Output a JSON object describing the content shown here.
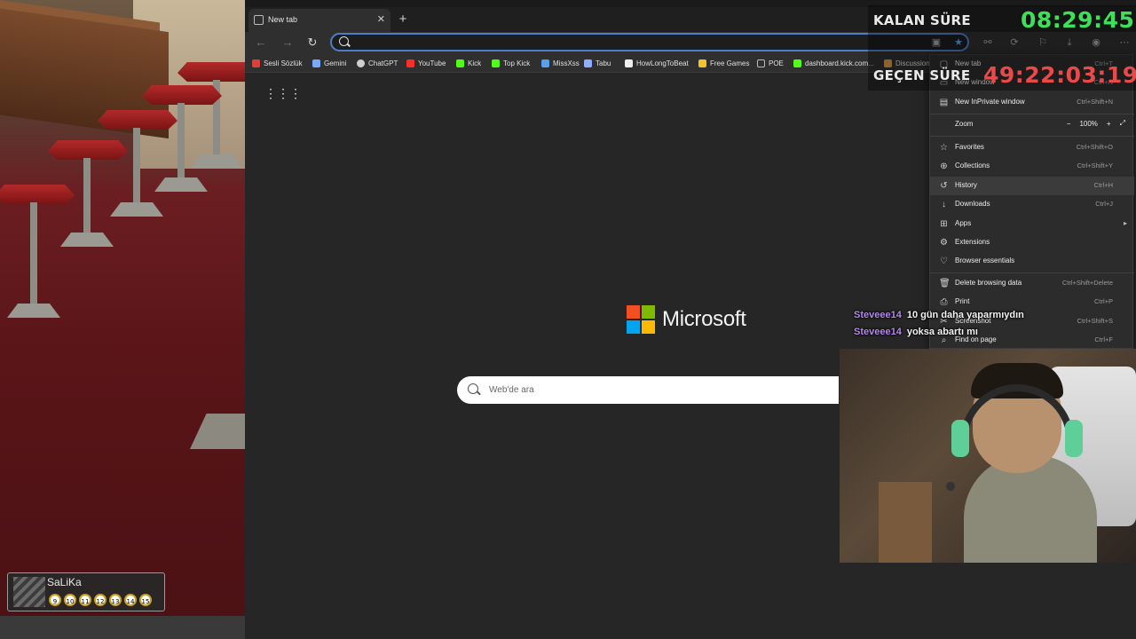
{
  "stream": {
    "timer": {
      "remaining_label": "KALAN SÜRE",
      "remaining_value": "08:29:45",
      "elapsed_label": "GEÇEN SÜRE",
      "elapsed_value": "49:22:03:19",
      "remaining_color": "#3ee05a",
      "elapsed_color": "#e84a4a"
    },
    "chat": [
      {
        "user": "Steveee14",
        "message": "10 gün daha yaparmıydın"
      },
      {
        "user": "Steveee14",
        "message": "yoksa abartı mı"
      }
    ],
    "game": {
      "player_name": "SaLiKa",
      "balls": [
        "9",
        "10",
        "11",
        "12",
        "13",
        "14",
        "15"
      ]
    }
  },
  "browser": {
    "tab": {
      "title": "New tab",
      "close_icon": "close-icon"
    },
    "new_tab_symbol": "+",
    "address": {
      "value": "",
      "placeholder": ""
    },
    "favorites": [
      {
        "label": "Sesli Sözlük",
        "color": "#d9413d"
      },
      {
        "label": "Gemini",
        "color": "#7aa7ff"
      },
      {
        "label": "ChatGPT",
        "color": "#cfcfcf"
      },
      {
        "label": "YouTube",
        "color": "#ff2a2a"
      },
      {
        "label": "Kick",
        "color": "#53fc18"
      },
      {
        "label": "Top Kick",
        "color": "#53fc18"
      },
      {
        "label": "MissXss",
        "color": "#5aa0e8"
      },
      {
        "label": "Tabu",
        "color": "#8fb0ff"
      },
      {
        "label": "HowLongToBeat",
        "color": "#eeeeee"
      },
      {
        "label": "Free Games",
        "color": "#f2c230"
      },
      {
        "label": "POE",
        "color": "#bbbbbb"
      },
      {
        "label": "dashboard.kick.com...",
        "color": "#53fc18"
      },
      {
        "label": "Discussion",
        "color": "#d39a4a"
      }
    ],
    "newtab": {
      "brand": "Microsoft",
      "search_placeholder": "Web'de ara"
    },
    "menu": {
      "items": [
        {
          "label": "New tab",
          "shortcut": "Ctrl+T",
          "icon": "new-tab-icon"
        },
        {
          "label": "New window",
          "shortcut": "Ctrl+N",
          "icon": "new-window-icon"
        },
        {
          "label": "New InPrivate window",
          "shortcut": "Ctrl+Shift+N",
          "icon": "inprivate-icon"
        },
        {
          "label": "Zoom",
          "shortcut": "",
          "icon": "zoom-icon"
        },
        {
          "label": "Favorites",
          "shortcut": "Ctrl+Shift+O",
          "icon": "star-icon"
        },
        {
          "label": "Collections",
          "shortcut": "Ctrl+Shift+Y",
          "icon": "collections-icon"
        },
        {
          "label": "History",
          "shortcut": "Ctrl+H",
          "icon": "history-icon"
        },
        {
          "label": "Downloads",
          "shortcut": "Ctrl+J",
          "icon": "download-icon"
        },
        {
          "label": "Apps",
          "shortcut": "",
          "icon": "apps-icon"
        },
        {
          "label": "Extensions",
          "shortcut": "",
          "icon": "extensions-icon"
        },
        {
          "label": "Browser essentials",
          "shortcut": "",
          "icon": "heart-icon"
        },
        {
          "label": "Delete browsing data",
          "shortcut": "Ctrl+Shift+Delete",
          "icon": "trash-icon"
        },
        {
          "label": "Print",
          "shortcut": "Ctrl+P",
          "icon": "print-icon"
        },
        {
          "label": "Screenshot",
          "shortcut": "Ctrl+Shift+S",
          "icon": "screenshot-icon"
        },
        {
          "label": "Find on page",
          "shortcut": "Ctrl+F",
          "icon": "find-icon"
        }
      ],
      "zoom": {
        "minus": "−",
        "value": "100%",
        "plus": "+",
        "fullscreen": "⤢"
      }
    }
  }
}
